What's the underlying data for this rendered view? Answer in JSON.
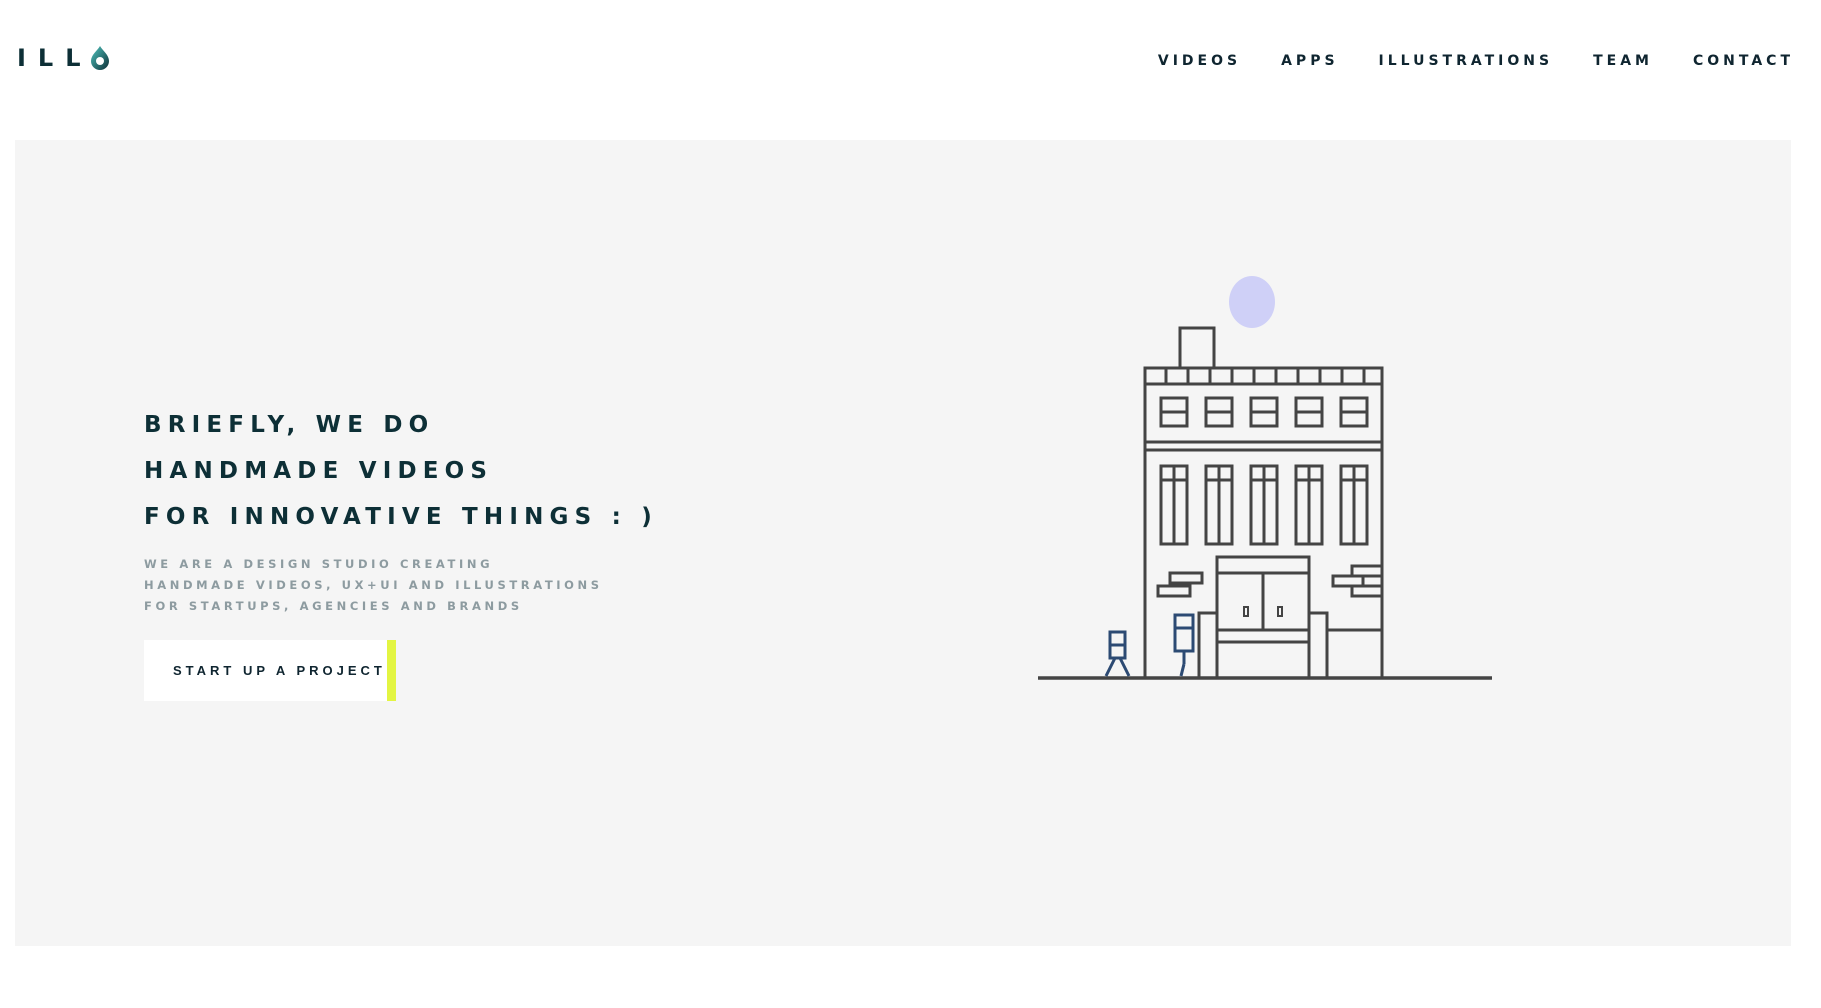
{
  "brand": {
    "logo_text": "ILL",
    "logo_icon": "water-drop-o-icon"
  },
  "nav": {
    "items": [
      {
        "label": "VIDEOS"
      },
      {
        "label": "APPS"
      },
      {
        "label": "ILLUSTRATIONS"
      },
      {
        "label": "TEAM"
      },
      {
        "label": "CONTACT"
      }
    ]
  },
  "hero": {
    "headline": [
      "BRIEFLY, WE DO",
      "HANDMADE VIDEOS",
      "FOR INNOVATIVE THINGS : )"
    ],
    "subtext": [
      "WE ARE A DESIGN STUDIO CREATING",
      "HANDMADE VIDEOS, UX+UI AND ILLUSTRATIONS",
      "FOR STARTUPS, AGENCIES AND BRANDS"
    ],
    "cta_label": "START UP A PROJECT",
    "illustration": "building-illustration"
  },
  "colors": {
    "brand_dark": "#0d2f36",
    "hero_bg": "#f5f5f5",
    "accent": "#e3f542",
    "moon": "#cfd0f7",
    "line": "#444444",
    "figure": "#2c4a73",
    "subtext": "#8d9ba0"
  }
}
